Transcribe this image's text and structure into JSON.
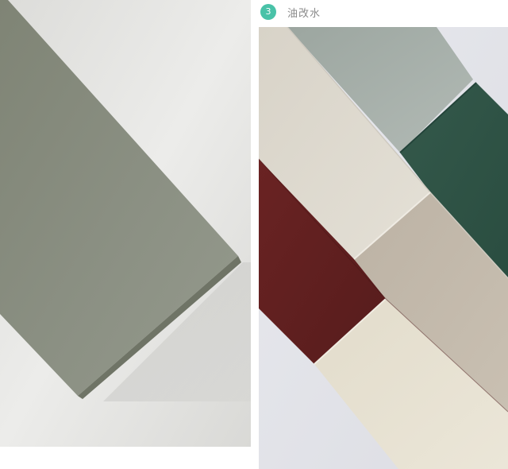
{
  "header": {
    "step_number": "3",
    "step_label": "油改水",
    "accent_color": "#49c2a8"
  },
  "photos": {
    "left": {
      "icon": "sage-green-panel-photo",
      "colors": [
        "#8a8f81",
        "#e8e8e6"
      ]
    },
    "right": {
      "icon": "color-swatch-panels-photo",
      "colors": [
        "#a7b0aa",
        "#2f5648",
        "#dad6cb",
        "#5e1f1f",
        "#c2b8aa",
        "#e6e0d0"
      ]
    }
  }
}
